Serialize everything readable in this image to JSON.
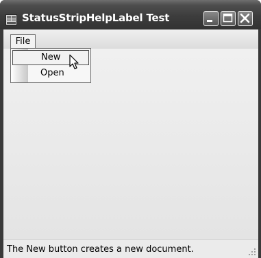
{
  "window": {
    "title": "StatusStripHelpLabel Test"
  },
  "menubar": {
    "file_label": "File"
  },
  "file_menu": {
    "items": [
      {
        "label": "New"
      },
      {
        "label": "Open"
      }
    ]
  },
  "statusbar": {
    "help_text": "The New button creates a new document."
  }
}
